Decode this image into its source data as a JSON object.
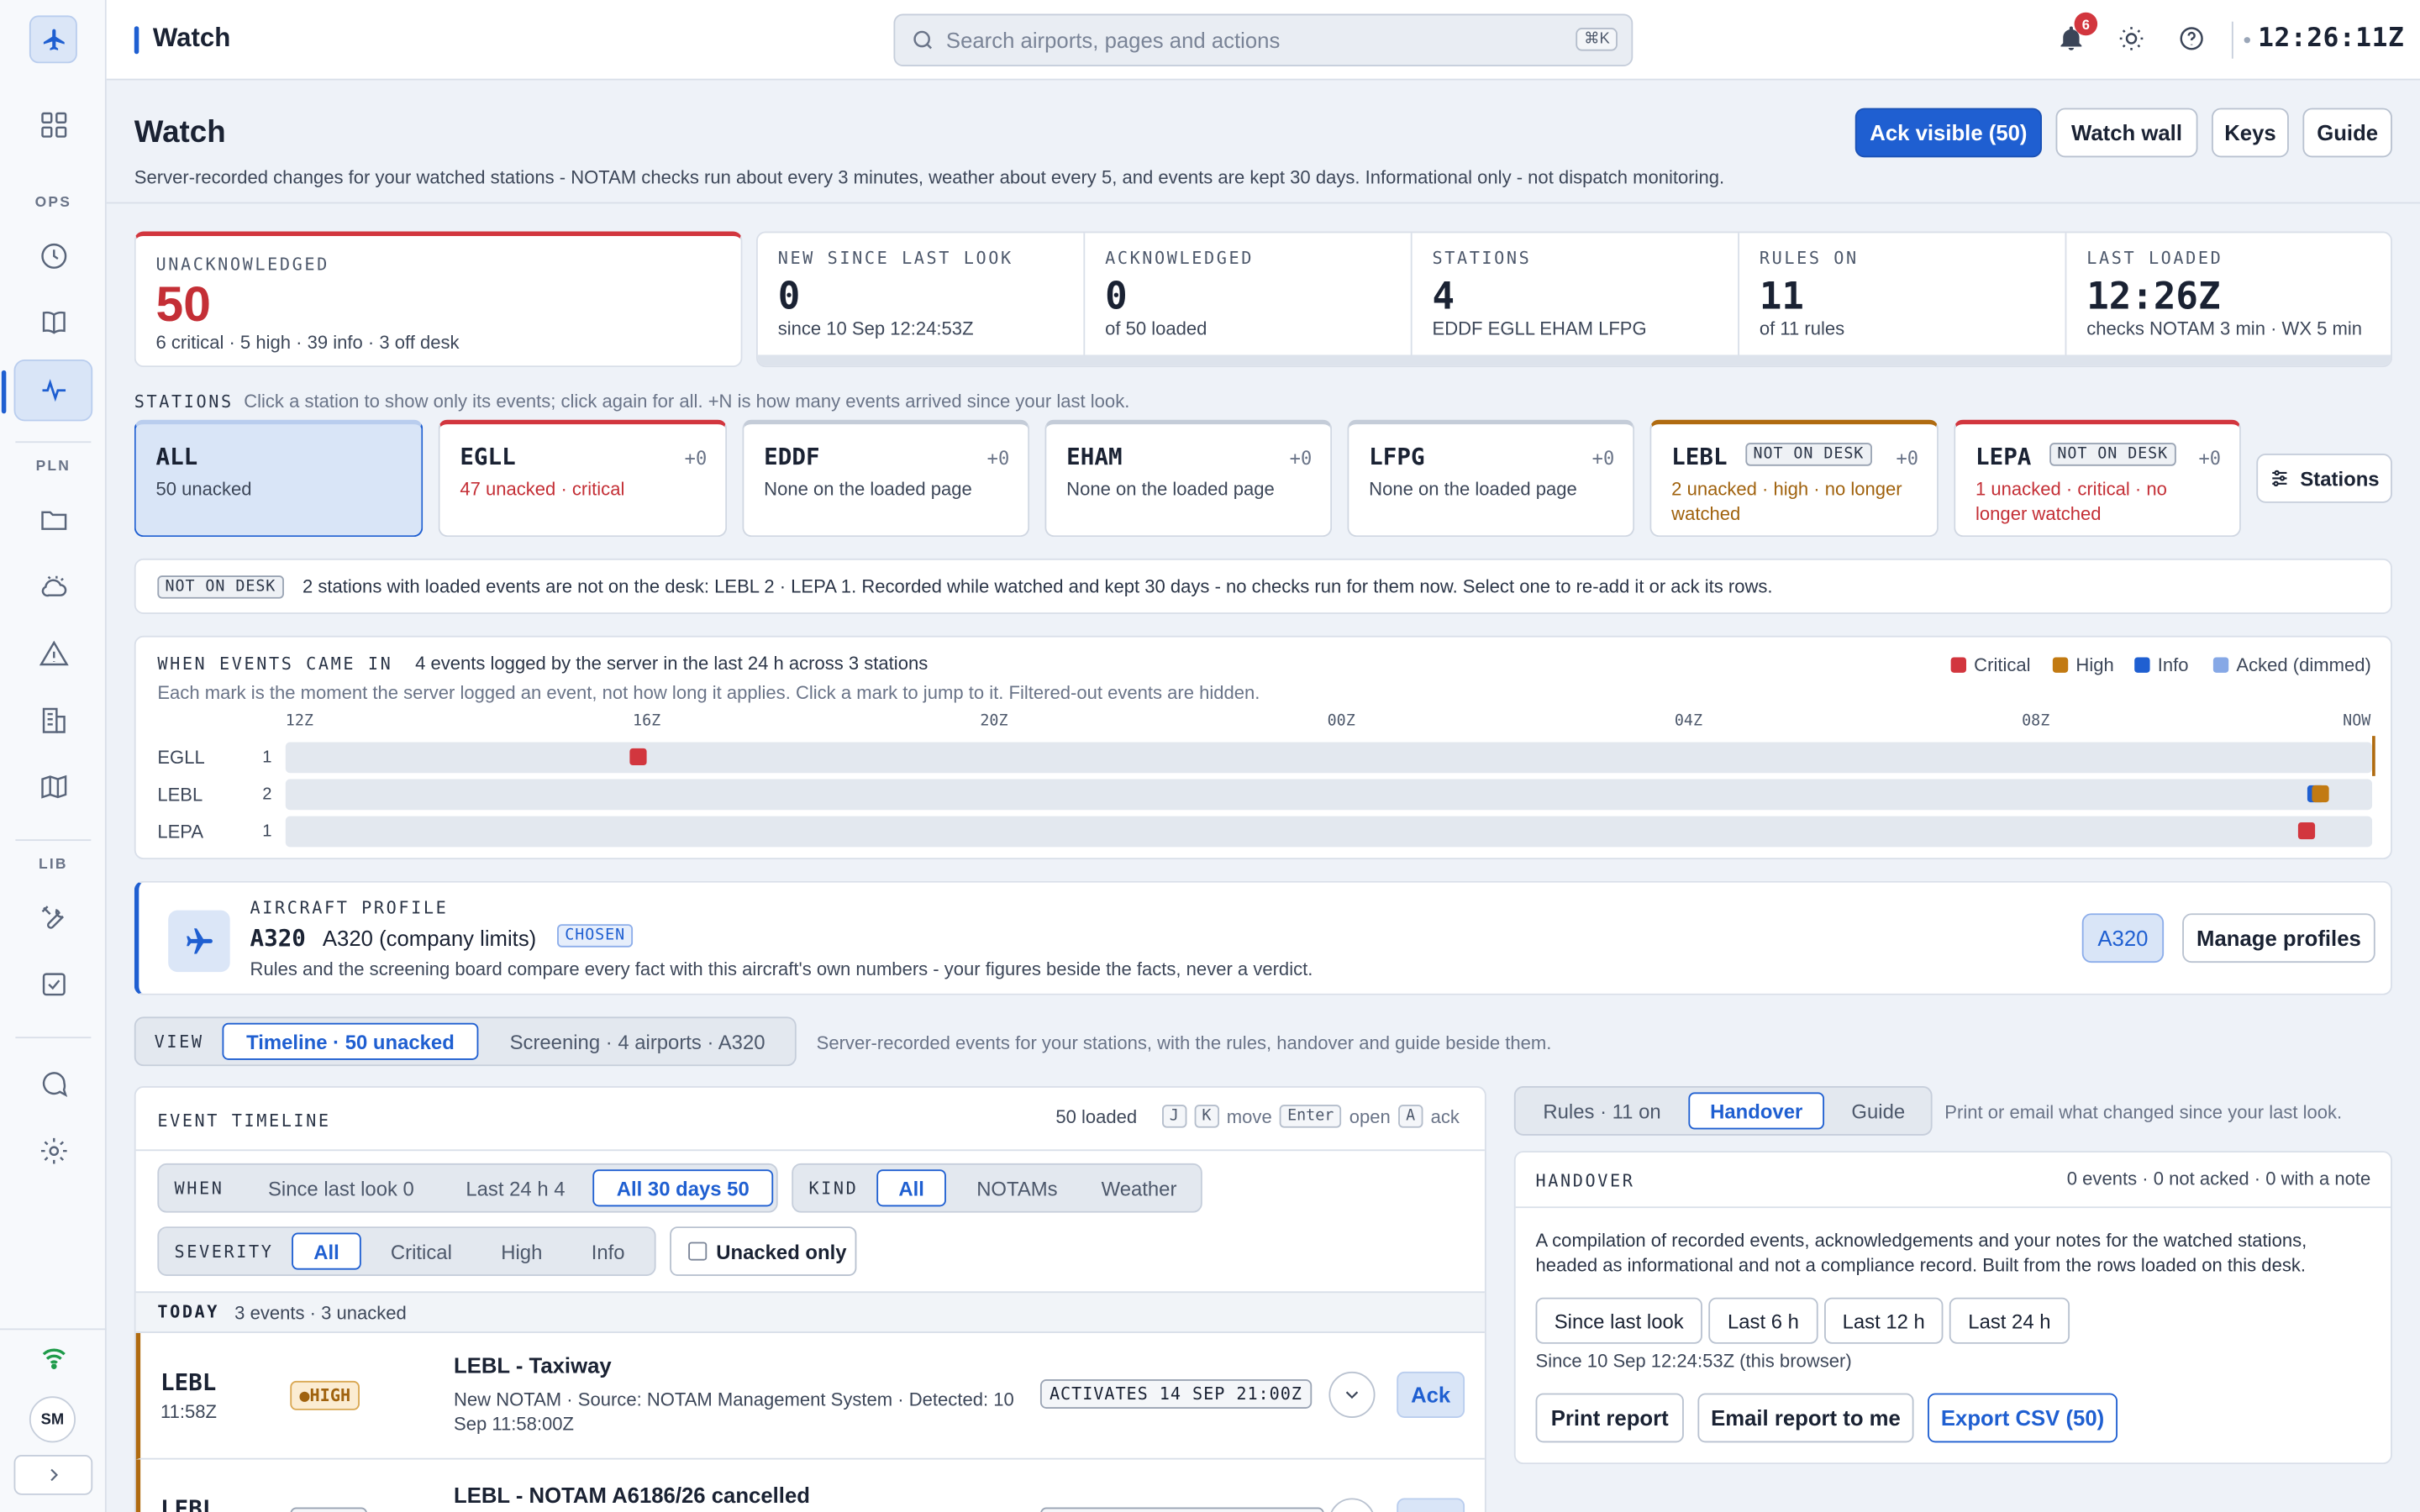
{
  "sidebar": {
    "groups": {
      "ops": "OPS",
      "pln": "PLN",
      "lib": "LIB"
    },
    "avatar": "SM"
  },
  "topbar": {
    "title": "Watch",
    "search_placeholder": "Search airports, pages and actions",
    "search_shortcut": "⌘K",
    "notification_count": "6",
    "clock": "12:26:11Z"
  },
  "header": {
    "title": "Watch",
    "subtitle": "Server-recorded changes for your watched stations - NOTAM checks run about every 3 minutes, weather about every 5, and events are kept 30 days. Informational only - not dispatch monitoring.",
    "buttons": {
      "ack_visible": "Ack visible (50)",
      "watch_wall": "Watch wall",
      "keys": "Keys",
      "guide": "Guide"
    }
  },
  "stats": {
    "unacknowledged": {
      "label": "UNACKNOWLEDGED",
      "value": "50",
      "sub": "6 critical · 5 high · 39 info · 3 off desk"
    },
    "new_since": {
      "label": "NEW SINCE LAST LOOK",
      "value": "0",
      "sub": "since 10 Sep 12:24:53Z"
    },
    "acknowledged": {
      "label": "ACKNOWLEDGED",
      "value": "0",
      "sub": "of 50 loaded"
    },
    "stations": {
      "label": "STATIONS",
      "value": "4",
      "sub": "EDDF EGLL EHAM LFPG"
    },
    "rules_on": {
      "label": "RULES ON",
      "value": "11",
      "sub": "of 11 rules"
    },
    "last_loaded": {
      "label": "LAST LOADED",
      "value": "12:26Z",
      "sub": "checks NOTAM 3 min · WX 5 min"
    }
  },
  "stations": {
    "label": "STATIONS",
    "hint": "Click a station to show only its events; click again for all. +N is how many events arrived since your last look.",
    "all": {
      "code": "ALL",
      "sub": "50 unacked"
    },
    "items": [
      {
        "code": "EGLL",
        "count": "+0",
        "sub": "47 unacked · critical"
      },
      {
        "code": "EDDF",
        "count": "+0",
        "sub": "None on the loaded page"
      },
      {
        "code": "EHAM",
        "count": "+0",
        "sub": "None on the loaded page"
      },
      {
        "code": "LFPG",
        "count": "+0",
        "sub": "None on the loaded page"
      },
      {
        "code": "LEBL",
        "tag": "NOT ON DESK",
        "count": "+0",
        "sub": "2 unacked · high · no longer watched"
      },
      {
        "code": "LEPA",
        "tag": "NOT ON DESK",
        "count": "+0",
        "sub": "1 unacked · critical · no longer watched"
      }
    ],
    "button": "Stations"
  },
  "not_on_desk": {
    "tag": "NOT ON DESK",
    "text": "2 stations with loaded events are not on the desk: LEBL 2 · LEPA 1. Recorded while watched and kept 30 days - no checks run for them now. Select one to re-add it or ack its rows."
  },
  "events_chart": {
    "label": "WHEN EVENTS CAME IN",
    "summary": "4 events logged by the server in the last 24 h across 3 stations",
    "hint": "Each mark is the moment the server logged an event, not how long it applies. Click a mark to jump to it. Filtered-out events are hidden.",
    "legend": [
      {
        "name": "Critical",
        "color": "#d2363e"
      },
      {
        "name": "High",
        "color": "#c27a12"
      },
      {
        "name": "Info",
        "color": "#1f5fd1"
      },
      {
        "name": "Acked (dimmed)",
        "color": "#86a8e6"
      }
    ]
  },
  "chart_data": {
    "type": "scatter",
    "title": "WHEN EVENTS CAME IN",
    "x_ticks": [
      "12Z",
      "16Z",
      "20Z",
      "00Z",
      "04Z",
      "08Z",
      "NOW"
    ],
    "x_range_hours": [
      -24,
      0
    ],
    "rows": [
      {
        "station": "EGLL",
        "count": "1",
        "events": [
          {
            "hours_before_now": 19.8,
            "severity": "Critical"
          }
        ]
      },
      {
        "station": "LEBL",
        "count": "2",
        "events": [
          {
            "hours_before_now": 0.5,
            "severity": "Info"
          },
          {
            "hours_before_now": 0.45,
            "severity": "High"
          }
        ]
      },
      {
        "station": "LEPA",
        "count": "1",
        "events": [
          {
            "hours_before_now": 0.6,
            "severity": "Critical"
          }
        ]
      }
    ]
  },
  "aircraft": {
    "label": "AIRCRAFT PROFILE",
    "type": "A320",
    "name": "A320 (company limits)",
    "chosen": "CHOSEN",
    "description": "Rules and the screening board compare every fact with this aircraft's own numbers - your figures beside the facts, never a verdict.",
    "selected_button": "A320",
    "manage_button": "Manage profiles"
  },
  "view": {
    "label": "VIEW",
    "tabs": [
      "Timeline · 50 unacked",
      "Screening · 4 airports · A320"
    ],
    "hint": "Server-recorded events for your stations, with the rules, handover and guide beside them."
  },
  "event_timeline": {
    "title": "EVENT TIMELINE",
    "loaded": "50 loaded",
    "keys": {
      "j": "J",
      "k": "K",
      "move": "move",
      "enter": "Enter",
      "open": "open",
      "a": "A",
      "ack": "ack"
    },
    "when": {
      "label": "WHEN",
      "options": [
        "Since last look 0",
        "Last 24 h 4",
        "All 30 days 50"
      ]
    },
    "kind": {
      "label": "KIND",
      "options": [
        "All",
        "NOTAMs",
        "Weather"
      ]
    },
    "severity": {
      "label": "SEVERITY",
      "options": [
        "All",
        "Critical",
        "High",
        "Info"
      ]
    },
    "unacked_only": "Unacked only",
    "today": {
      "label": "TODAY",
      "summary": "3 events · 3 unacked"
    },
    "rows": [
      {
        "station": "LEBL",
        "time": "11:58Z",
        "severity": "●HIGH",
        "title": "LEBL - Taxiway",
        "detail": "New NOTAM · Source: NOTAM Management System · Detected: 10 Sep 11:58:00Z",
        "pill": "ACTIVATES 14 SEP 21:00Z",
        "ack": "Ack"
      },
      {
        "station": "LEBL",
        "title": "LEBL - NOTAM A6186/26 cancelled",
        "ack": "Ack"
      }
    ]
  },
  "right_panel": {
    "tabs": [
      "Rules · 11 on",
      "Handover",
      "Guide"
    ],
    "hint": "Print or email what changed since your last look.",
    "handover": {
      "title": "HANDOVER",
      "summary": "0 events · 0 not acked · 0 with a note",
      "description": "A compilation of recorded events, acknowledgements and your notes for the watched stations, headed as informational and not a compliance record. Built from the rows loaded on this desk.",
      "ranges": [
        "Since last look",
        "Last 6 h",
        "Last 12 h",
        "Last 24 h"
      ],
      "since": "Since 10 Sep 12:24:53Z (this browser)",
      "actions": {
        "print": "Print report",
        "email": "Email report to me",
        "export": "Export CSV (50)"
      }
    }
  }
}
